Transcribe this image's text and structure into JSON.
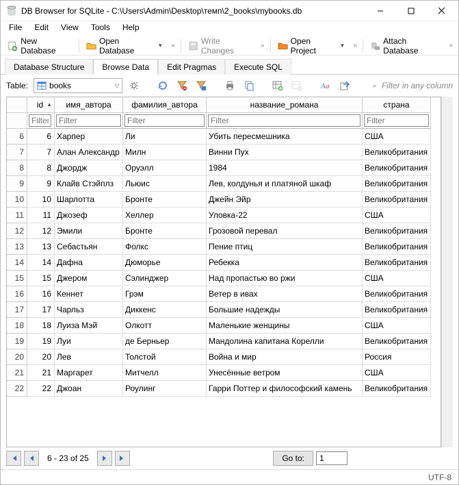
{
  "window": {
    "title": "DB Browser for SQLite - C:\\Users\\Admin\\Desktop\\темп\\2_books\\mybooks.db"
  },
  "menubar": {
    "file": "File",
    "edit": "Edit",
    "view": "View",
    "tools": "Tools",
    "help": "Help"
  },
  "toolbar": {
    "new_db": "New Database",
    "open_db": "Open Database",
    "write_changes": "Write Changes",
    "open_project": "Open Project",
    "attach_db": "Attach Database"
  },
  "tabs": {
    "structure": "Database Structure",
    "browse": "Browse Data",
    "pragmas": "Edit Pragmas",
    "execute": "Execute SQL"
  },
  "browse": {
    "table_label": "Table:",
    "table_selected": "books",
    "filter_any_placeholder": "Filter in any column"
  },
  "columns": {
    "id": "id",
    "first": "имя_автора",
    "last": "фамилия_автора",
    "title": "название_романа",
    "country": "страна"
  },
  "filter_placeholder": "Filter",
  "rows": [
    {
      "n": "6",
      "id": "6",
      "first": "Харпер",
      "last": "Ли",
      "title": "Убить пересмешника",
      "country": "США"
    },
    {
      "n": "7",
      "id": "7",
      "first": "Алан Александр",
      "last": "Милн",
      "title": "Винни Пух",
      "country": "Великобритания"
    },
    {
      "n": "8",
      "id": "8",
      "first": "Джордж",
      "last": "Оруэлл",
      "title": "1984",
      "country": "Великобритания"
    },
    {
      "n": "9",
      "id": "9",
      "first": "Клайв Стэйплз",
      "last": "Льюис",
      "title": "Лев, колдунья и платяной шкаф",
      "country": "Великобритания"
    },
    {
      "n": "10",
      "id": "10",
      "first": "Шарлотта",
      "last": "Бронте",
      "title": "Джейн Эйр",
      "country": "Великобритания"
    },
    {
      "n": "11",
      "id": "11",
      "first": "Джозеф",
      "last": "Хеллер",
      "title": "Уловка-22",
      "country": "США"
    },
    {
      "n": "12",
      "id": "12",
      "first": "Эмили",
      "last": "Бронте",
      "title": "Грозовой перевал",
      "country": "Великобритания"
    },
    {
      "n": "13",
      "id": "13",
      "first": "Себастьян",
      "last": "Фолкс",
      "title": "Пение птиц",
      "country": "Великобритания"
    },
    {
      "n": "14",
      "id": "14",
      "first": "Дафна",
      "last": "Дюморье",
      "title": "Ребекка",
      "country": "Великобритания"
    },
    {
      "n": "15",
      "id": "15",
      "first": "Джером",
      "last": "Сэлинджер",
      "title": "Над пропастью во ржи",
      "country": "США"
    },
    {
      "n": "16",
      "id": "16",
      "first": "Кеннет",
      "last": "Грэм",
      "title": "Ветер в ивах",
      "country": "Великобритания"
    },
    {
      "n": "17",
      "id": "17",
      "first": "Чарльз",
      "last": "Диккенс",
      "title": "Большие надежды",
      "country": "Великобритания"
    },
    {
      "n": "18",
      "id": "18",
      "first": "Луиза Мэй",
      "last": "Олкотт",
      "title": "Маленькие женщины",
      "country": "США"
    },
    {
      "n": "19",
      "id": "19",
      "first": "Луи",
      "last": "де Берньер",
      "title": "Мандолина капитана Корелли",
      "country": "Великобритания"
    },
    {
      "n": "20",
      "id": "20",
      "first": "Лев",
      "last": "Толстой",
      "title": "Война и мир",
      "country": "Россия"
    },
    {
      "n": "21",
      "id": "21",
      "first": "Маргарет",
      "last": "Митчелл",
      "title": "Унесённые ветром",
      "country": "США"
    },
    {
      "n": "22",
      "id": "22",
      "first": "Джоан",
      "last": "Роулинг",
      "title": "Гарри Поттер и философский камень",
      "country": "Великобритания"
    }
  ],
  "pager": {
    "range": "6 - 23 of 25",
    "goto_label": "Go to:",
    "goto_value": "1"
  },
  "status": {
    "encoding": "UTF-8"
  },
  "colors": {
    "db_icon": "#7f8c8d",
    "folder": "#f5c044",
    "disk_grey": "#bfbfbf",
    "open_proj": "#f08a2c",
    "attach": "#8a8a8a",
    "refresh": "#3b7dd8",
    "funnel": "#c78f3a",
    "print": "#555",
    "nav_blue": "#2f6fc4"
  }
}
